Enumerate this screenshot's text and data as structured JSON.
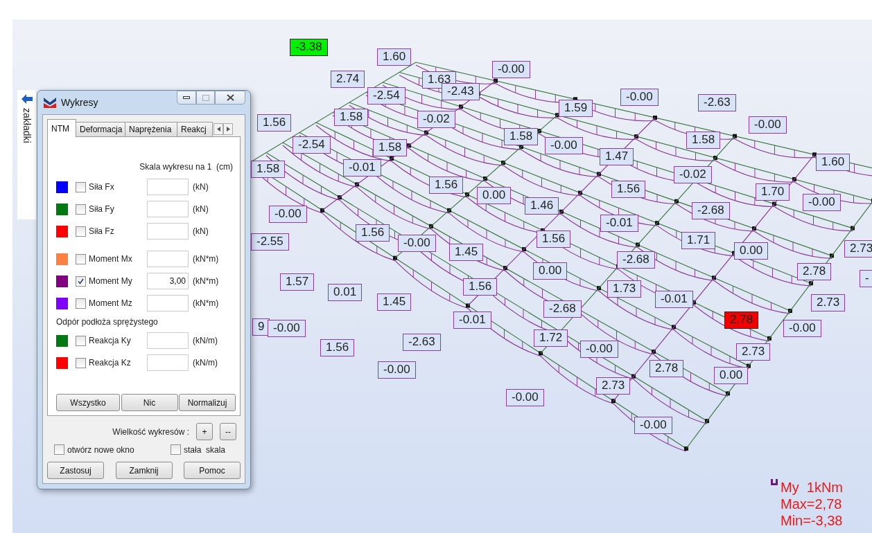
{
  "sidebar_tab": {
    "label": "zakładki"
  },
  "dialog": {
    "title": "Wykresy",
    "tabs": [
      {
        "label": "NTM",
        "selected": true
      },
      {
        "label": "Deformacja",
        "selected": false
      },
      {
        "label": "Naprężenia",
        "selected": false
      },
      {
        "label": "Reakcj",
        "selected": false
      }
    ],
    "scale_caption": "Skala wykresu na 1  (cm)",
    "groups": [
      {
        "rows": [
          {
            "label": "Siła Fx",
            "color": "#0000ff",
            "checked": false,
            "unit": "(kN)"
          },
          {
            "label": "Siła Fy",
            "color": "#007a10",
            "checked": false,
            "unit": "(kN)"
          },
          {
            "label": "Siła Fz",
            "color": "#ff0000",
            "checked": false,
            "unit": "(kN)"
          }
        ]
      },
      {
        "rows": [
          {
            "label": "Moment Mx",
            "color": "#ff8040",
            "checked": false,
            "unit": "(kN*m)"
          },
          {
            "label": "Moment My",
            "color": "#800080",
            "checked": true,
            "value": "3,00",
            "unit": "(kN*m)"
          },
          {
            "label": "Moment Mz",
            "color": "#8000ff",
            "checked": false,
            "unit": "(kN*m)"
          }
        ]
      },
      {
        "heading": "Odpór podłoża sprężystego",
        "rows": [
          {
            "label": "Reakcja Ky",
            "color": "#007a10",
            "checked": false,
            "unit": "(kN/m)"
          },
          {
            "label": "Reakcja Kz",
            "color": "#ff0000",
            "checked": false,
            "unit": "(kN/m)"
          }
        ]
      }
    ],
    "action_buttons": [
      "Wszystko",
      "Nic",
      "Normalizuj"
    ],
    "size_label": "Wielkość wykresów :",
    "size_buttons": [
      "+",
      "--"
    ],
    "options": [
      {
        "label": "otwórz nowe okno",
        "checked": false
      },
      {
        "label": "stała  skala",
        "checked": false
      }
    ],
    "footer_buttons": [
      "Zastosuj",
      "Zamknij",
      "Pomoc"
    ]
  },
  "diagram": {
    "labels": [
      {
        "text": "-3.38",
        "kind": "min"
      },
      {
        "text": "1.60",
        "kind": "value"
      },
      {
        "text": "-0.00",
        "kind": "value"
      },
      {
        "text": "2.74",
        "kind": "value"
      },
      {
        "text": "1.63",
        "kind": "value"
      },
      {
        "text": "-2.54",
        "kind": "value"
      },
      {
        "text": "-2.43",
        "kind": "value"
      },
      {
        "text": "-0.00",
        "kind": "value"
      },
      {
        "text": "1.59",
        "kind": "value"
      },
      {
        "text": "-2.63",
        "kind": "value"
      },
      {
        "text": "1.56",
        "kind": "value"
      },
      {
        "text": "1.58",
        "kind": "value"
      },
      {
        "text": "-0.02",
        "kind": "value"
      },
      {
        "text": "-0.00",
        "kind": "value"
      },
      {
        "text": "-2.54",
        "kind": "value"
      },
      {
        "text": "1.58",
        "kind": "value"
      },
      {
        "text": "1.58",
        "kind": "value"
      },
      {
        "text": "-0.00",
        "kind": "value"
      },
      {
        "text": "1.58",
        "kind": "value"
      },
      {
        "text": "1.58",
        "kind": "value"
      },
      {
        "text": "-0.01",
        "kind": "value"
      },
      {
        "text": "1.47",
        "kind": "value"
      },
      {
        "text": "-0.02",
        "kind": "value"
      },
      {
        "text": "1.60",
        "kind": "value"
      },
      {
        "text": "-0.00",
        "kind": "value"
      },
      {
        "text": "1.56",
        "kind": "value"
      },
      {
        "text": "0.00",
        "kind": "value"
      },
      {
        "text": "1.46",
        "kind": "value"
      },
      {
        "text": "1.56",
        "kind": "value"
      },
      {
        "text": "-2.68",
        "kind": "value"
      },
      {
        "text": "1.70",
        "kind": "value"
      },
      {
        "text": "-0.00",
        "kind": "value"
      },
      {
        "text": "-0.01",
        "kind": "value"
      },
      {
        "text": "-2.55",
        "kind": "value"
      },
      {
        "text": "1.56",
        "kind": "value"
      },
      {
        "text": "-0.00",
        "kind": "value"
      },
      {
        "text": "1.45",
        "kind": "value"
      },
      {
        "text": "1.56",
        "kind": "value"
      },
      {
        "text": "1.71",
        "kind": "value"
      },
      {
        "text": "0.00",
        "kind": "value"
      },
      {
        "text": "2.73",
        "kind": "value"
      },
      {
        "text": "-2.68",
        "kind": "value"
      },
      {
        "text": "1.57",
        "kind": "value"
      },
      {
        "text": "0.01",
        "kind": "value"
      },
      {
        "text": "1.45",
        "kind": "value"
      },
      {
        "text": "1.56",
        "kind": "value"
      },
      {
        "text": "0.00",
        "kind": "value"
      },
      {
        "text": "-2.68",
        "kind": "value"
      },
      {
        "text": "1.73",
        "kind": "value"
      },
      {
        "text": "-0.01",
        "kind": "value"
      },
      {
        "text": "2.78",
        "kind": "value"
      },
      {
        "text": "2.73",
        "kind": "value"
      },
      {
        "text": "-",
        "kind": "value"
      },
      {
        "text": "9",
        "kind": "value"
      },
      {
        "text": "-0.00",
        "kind": "value"
      },
      {
        "text": "-0.01",
        "kind": "value"
      },
      {
        "text": "2.78",
        "kind": "max"
      },
      {
        "text": "-0.00",
        "kind": "value"
      },
      {
        "text": "-2.63",
        "kind": "value"
      },
      {
        "text": "1.72",
        "kind": "value"
      },
      {
        "text": "1.56",
        "kind": "value"
      },
      {
        "text": "-0.00",
        "kind": "value"
      },
      {
        "text": "2.73",
        "kind": "value"
      },
      {
        "text": "-0.00",
        "kind": "value"
      },
      {
        "text": "2.78",
        "kind": "value"
      },
      {
        "text": "0.00",
        "kind": "value"
      },
      {
        "text": "2.73",
        "kind": "value"
      },
      {
        "text": "-0.00",
        "kind": "value"
      },
      {
        "text": "-0.00",
        "kind": "value"
      }
    ]
  },
  "legend": {
    "quantity": "My  1kNm",
    "max": "Max=2,78",
    "min": "Min=-3,38"
  }
}
